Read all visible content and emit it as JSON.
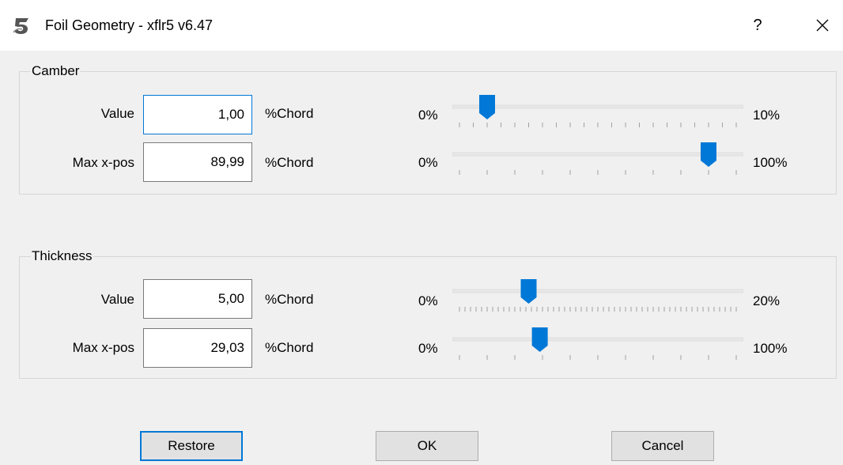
{
  "window": {
    "title": "Foil Geometry - xflr5 v6.47",
    "help_label": "?"
  },
  "camber": {
    "group_title": "Camber",
    "value": {
      "label": "Value",
      "input": "1,00",
      "unit": "%Chord",
      "min_label": "0%",
      "max_label": "10%",
      "slider_fraction": 0.1,
      "tick_count": 21
    },
    "max_x_pos": {
      "label": "Max x-pos",
      "input": "89,99",
      "unit": "%Chord",
      "min_label": "0%",
      "max_label": "100%",
      "slider_fraction": 0.8999,
      "tick_count": 11
    }
  },
  "thickness": {
    "group_title": "Thickness",
    "value": {
      "label": "Value",
      "input": "5,00",
      "unit": "%Chord",
      "min_label": "0%",
      "max_label": "20%",
      "slider_fraction": 0.25,
      "tick_count": 51
    },
    "max_x_pos": {
      "label": "Max x-pos",
      "input": "29,03",
      "unit": "%Chord",
      "min_label": "0%",
      "max_label": "100%",
      "slider_fraction": 0.2903,
      "tick_count": 11
    }
  },
  "buttons": {
    "restore": "Restore",
    "ok": "OK",
    "cancel": "Cancel"
  },
  "colors": {
    "accent": "#0078d7",
    "slider_track": "#e7e7e7",
    "tick": "#a0a0a0",
    "window_bg": "#f0f0f0"
  },
  "icons": {
    "app": "xflr5-logo-icon",
    "help": "help-icon",
    "close": "close-icon"
  }
}
